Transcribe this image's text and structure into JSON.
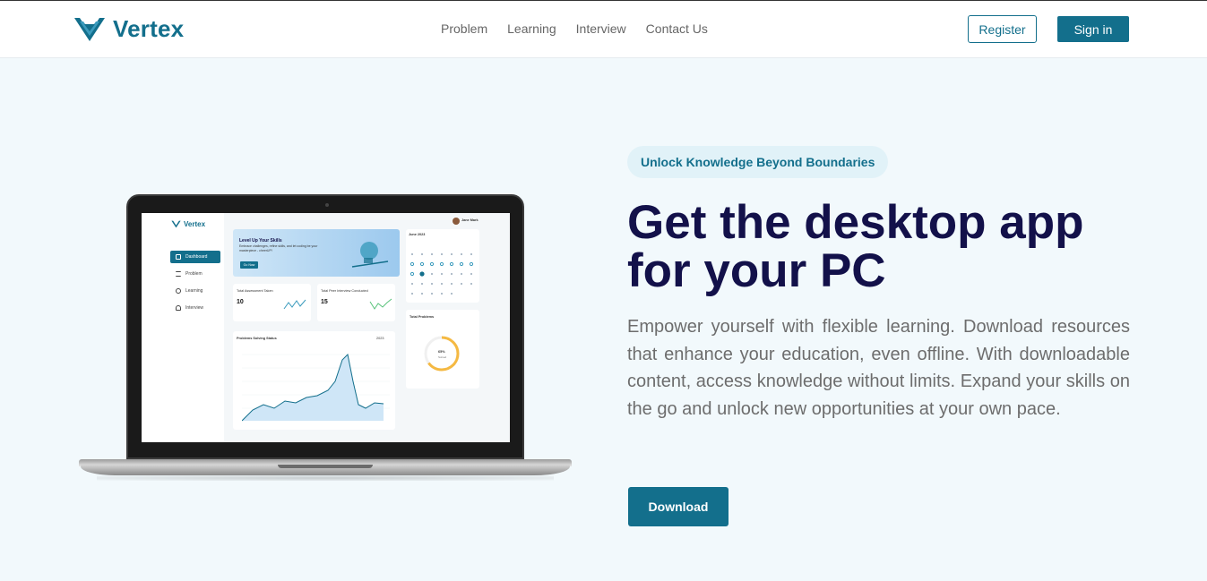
{
  "header": {
    "brand": "Vertex",
    "nav": [
      "Problem",
      "Learning",
      "Interview",
      "Contact Us"
    ],
    "register_label": "Register",
    "signin_label": "Sign in"
  },
  "hero": {
    "pill": "Unlock Knowledge Beyond Boundaries",
    "headline": "Get the desktop app for your PC",
    "lead": "Empower yourself with flexible learning. Download resources that enhance your education, even offline. With downloadable content, access knowledge without limits. Expand your skills on the go and unlock new opportunities at your own pace.",
    "download_label": "Download"
  },
  "mockup": {
    "brand": "Vertex",
    "nav": [
      "Dashboard",
      "Problem",
      "Learning",
      "Interview"
    ],
    "banner_title": "Level Up Your Skills",
    "banner_text": "Embrace challenges, refine skills, and let coding be your masterpiece - cheerUP!",
    "banner_button": "Go Now",
    "card1_label": "Total Assessment Taken",
    "card1_value": "10",
    "card2_label": "Total Peer Interview Conducted",
    "card2_value": "15",
    "chart_title": "Problems Solving Status",
    "chart_year": "2023",
    "calendar_month": "June 2023",
    "user": "Jane Mark",
    "problems_title": "Total Problems",
    "problems_pct": "65%",
    "problems_sub": "Solved",
    "colors": {
      "accent": "#136f8c",
      "ring": "#f5b942"
    }
  }
}
